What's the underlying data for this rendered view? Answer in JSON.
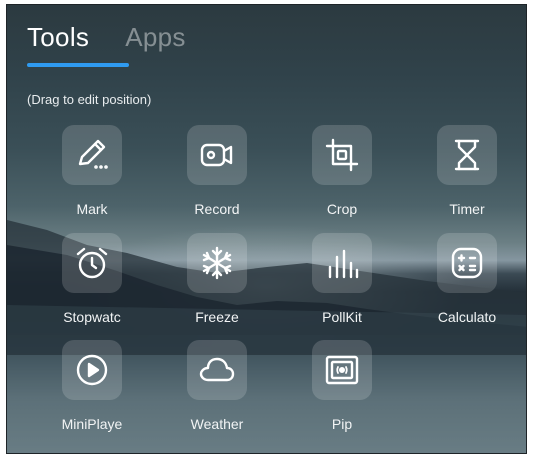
{
  "tabs": [
    {
      "label": "Tools",
      "active": true
    },
    {
      "label": "Apps",
      "active": false
    }
  ],
  "accent_color": "#2f9bf1",
  "hint": "(Drag to edit position)",
  "tools": [
    {
      "label": "Mark",
      "icon": "pencil-icon"
    },
    {
      "label": "Record",
      "icon": "video-camera-icon"
    },
    {
      "label": "Crop",
      "icon": "crop-icon"
    },
    {
      "label": "Timer",
      "icon": "hourglass-icon"
    },
    {
      "label": "Stopwatc",
      "icon": "alarm-clock-icon"
    },
    {
      "label": "Freeze",
      "icon": "snowflake-icon"
    },
    {
      "label": "PollKit",
      "icon": "bar-chart-icon"
    },
    {
      "label": "Calculato",
      "icon": "calculator-icon"
    },
    {
      "label": "MiniPlaye",
      "icon": "play-circle-icon"
    },
    {
      "label": "Weather",
      "icon": "cloud-icon"
    },
    {
      "label": "Pip",
      "icon": "picture-in-picture-icon"
    }
  ]
}
